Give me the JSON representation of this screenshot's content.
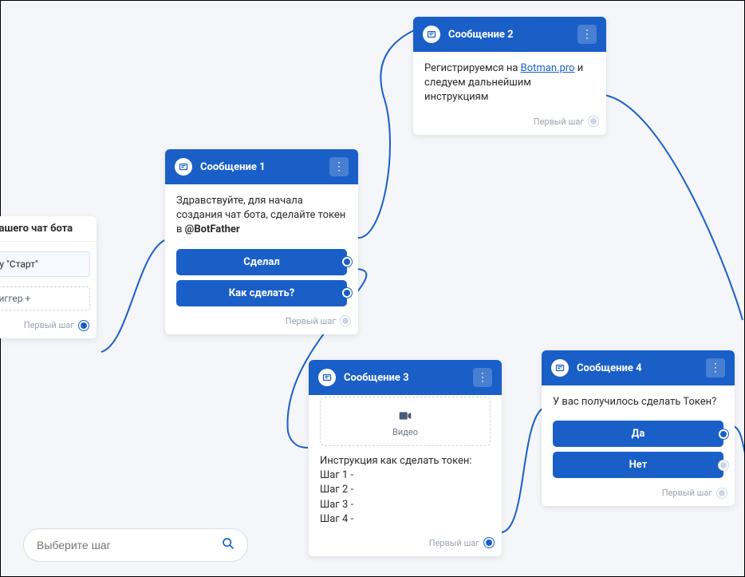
{
  "search": {
    "placeholder": "Выберите шаг"
  },
  "trigger_node": {
    "header": "а вашего чат бота",
    "start_button": "пку \"Старт\"",
    "add_trigger": "триггер  +",
    "footer": "Первый шаг"
  },
  "nodes": {
    "msg1": {
      "title": "Сообщение 1",
      "body_pre": "Здравствуйте, для начала создания чат бота, сделайте токен в ",
      "body_bold": "@BotFather",
      "btn1": "Сделал",
      "btn2": "Как сделать?",
      "footer": "Первый шаг"
    },
    "msg2": {
      "title": "Сообщение 2",
      "body_pre": "Регистрируемся на ",
      "body_link": "Botman.pro",
      "body_post": " и следуем дальнейшим инструкциям",
      "footer": "Первый шаг"
    },
    "msg3": {
      "title": "Сообщение 3",
      "video_label": "Видео",
      "body_lines": "Инструкция как сделать токен:\nШаг 1 -\nШаг 2 -\nШаг 3 -\nШаг 4 -",
      "footer": "Первый шаг"
    },
    "msg4": {
      "title": "Сообщение 4",
      "body": "У вас получилось сделать Токен?",
      "btn1": "Да",
      "btn2": "Нет",
      "footer": "Первый шаг"
    }
  }
}
